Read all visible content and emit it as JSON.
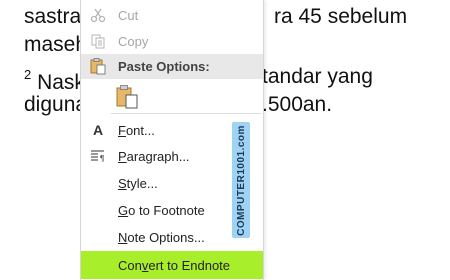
{
  "document": {
    "line1_left": "sastra",
    "line1_right": "ra 45 sebelum",
    "line2_left": "maseh",
    "line3_sup": "2",
    "line3_left": "Nask",
    "line3_right": "tandar yang",
    "line4_left": "diguna",
    "line4_right": ".500an."
  },
  "context_menu": {
    "cut_label": "Cut",
    "copy_label": "Copy",
    "paste_options_label": "Paste Options:",
    "font_label": "Font...",
    "paragraph_label": "Paragraph...",
    "style_label": "Style...",
    "go_to_footnote_label": "Go to Footnote",
    "note_options_label": "Note Options...",
    "convert_to_endnote_label": "Convert to Endnote",
    "highlight_color": "#a8ee2a"
  },
  "watermark": {
    "text": "COMPUTER1001.com"
  },
  "icons": {
    "cut": "scissors-icon",
    "copy": "copy-icon",
    "paste": "clipboard-icon",
    "font": "font-A-icon",
    "paragraph": "paragraph-icon"
  }
}
